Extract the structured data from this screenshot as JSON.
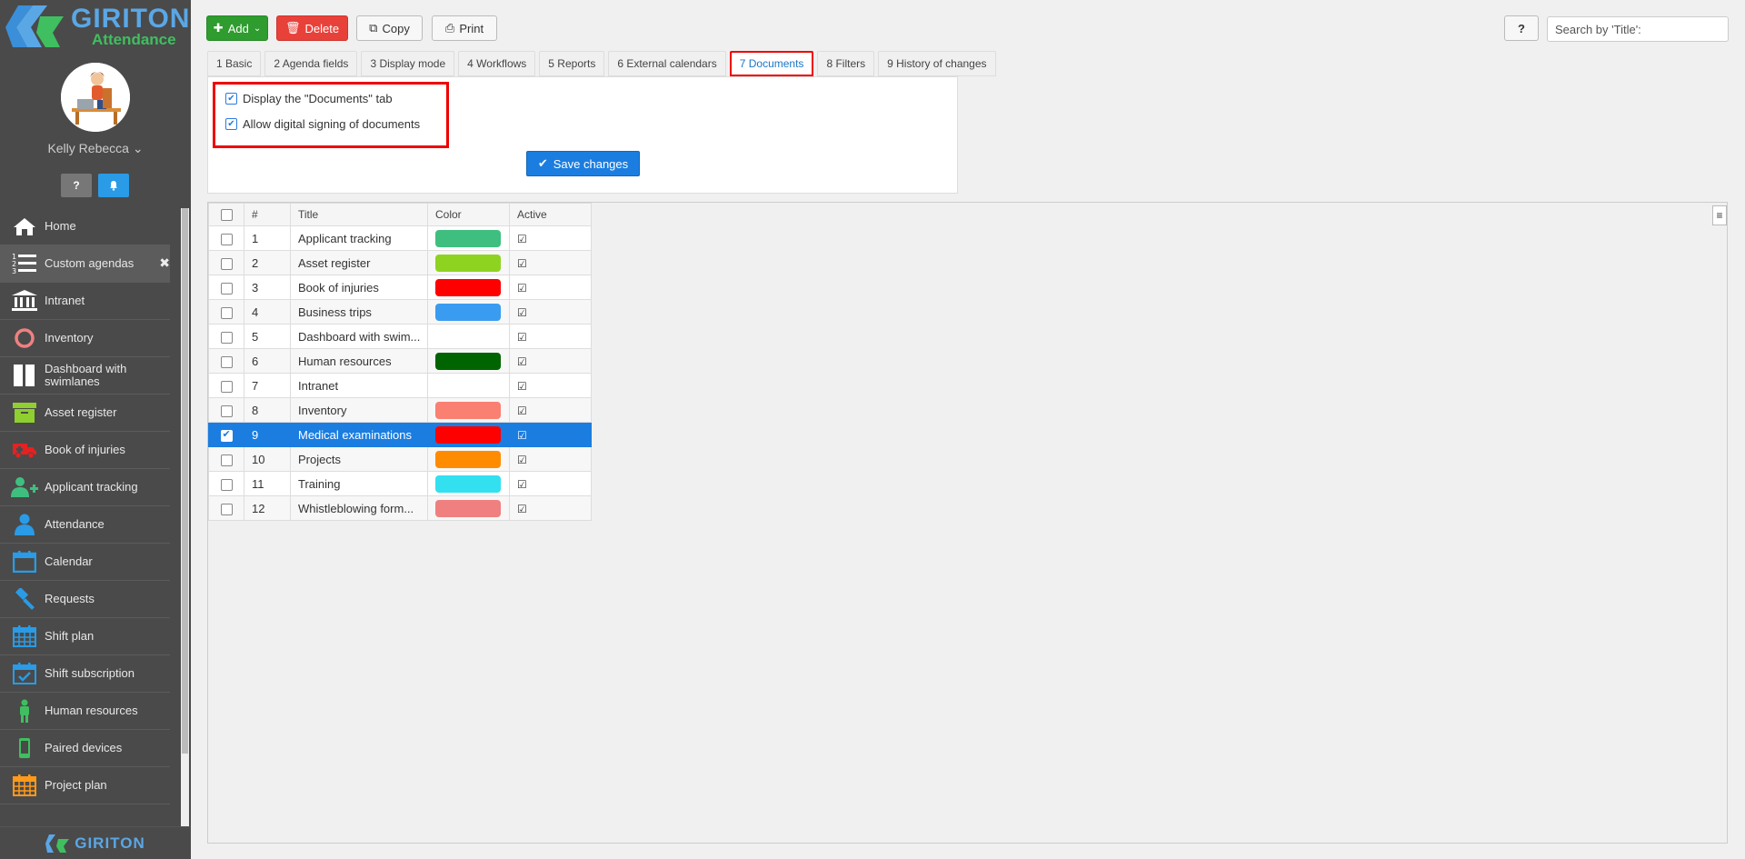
{
  "brand": {
    "name": "GIRITON",
    "product": "Attendance",
    "footer_name": "GIRITON"
  },
  "user": {
    "name": "Kelly Rebecca"
  },
  "sidebar": {
    "help_label": "?",
    "items": [
      {
        "label": "Home",
        "icon": "home-icon",
        "color": "#ffffff"
      },
      {
        "label": "Custom agendas",
        "icon": "numbered-list-icon",
        "color": "#ffffff",
        "active": true,
        "close": "✖"
      },
      {
        "label": "Intranet",
        "icon": "building-icon",
        "color": "#ffffff"
      },
      {
        "label": "Inventory",
        "icon": "circle-icon",
        "color": "#f08080"
      },
      {
        "label": "Dashboard with swimlanes",
        "icon": "columns-icon",
        "color": "#ffffff"
      },
      {
        "label": "Asset register",
        "icon": "archive-box-icon",
        "color": "#8fcf2f"
      },
      {
        "label": "Book of injuries",
        "icon": "ambulance-icon",
        "color": "#e82020"
      },
      {
        "label": "Applicant tracking",
        "icon": "user-plus-icon",
        "color": "#3fbf7f"
      },
      {
        "label": "Attendance",
        "icon": "user-icon",
        "color": "#2a9be6"
      },
      {
        "label": "Calendar",
        "icon": "calendar-icon",
        "color": "#2a9be6"
      },
      {
        "label": "Requests",
        "icon": "gavel-icon",
        "color": "#2a9be6"
      },
      {
        "label": "Shift plan",
        "icon": "calendar-grid-icon",
        "color": "#2a9be6"
      },
      {
        "label": "Shift subscription",
        "icon": "calendar-check-icon",
        "color": "#2a9be6"
      },
      {
        "label": "Human resources",
        "icon": "person-icon",
        "color": "#3fbf5f"
      },
      {
        "label": "Paired devices",
        "icon": "mobile-icon",
        "color": "#3fbf5f"
      },
      {
        "label": "Project plan",
        "icon": "calendar-grid-icon",
        "color": "#ff9a1a"
      }
    ]
  },
  "toolbar": {
    "add": "Add",
    "delete": "Delete",
    "copy": "Copy",
    "print": "Print",
    "help": "?",
    "search_placeholder": "Search by 'Title':"
  },
  "tabs": [
    {
      "label": "1 Basic"
    },
    {
      "label": "2 Agenda fields"
    },
    {
      "label": "3 Display mode"
    },
    {
      "label": "4 Workflows"
    },
    {
      "label": "5 Reports"
    },
    {
      "label": "6 External calendars"
    },
    {
      "label": "7 Documents",
      "active": true
    },
    {
      "label": "8 Filters"
    },
    {
      "label": "9 History of changes"
    }
  ],
  "documents_settings": {
    "display_tab": {
      "label": "Display the \"Documents\" tab",
      "checked": true
    },
    "digital_signing": {
      "label": "Allow digital signing of documents",
      "checked": true
    },
    "save_label": "Save changes"
  },
  "grid": {
    "columns": [
      "#",
      "Title",
      "Color",
      "Active"
    ],
    "rows": [
      {
        "num": "1",
        "title": "Applicant tracking",
        "color": "#3fbf7f",
        "active": true,
        "selected": false
      },
      {
        "num": "2",
        "title": "Asset register",
        "color": "#8fd321",
        "active": true,
        "selected": false
      },
      {
        "num": "3",
        "title": "Book of injuries",
        "color": "#ff0000",
        "active": true,
        "selected": false
      },
      {
        "num": "4",
        "title": "Business trips",
        "color": "#3a9cf0",
        "active": true,
        "selected": false
      },
      {
        "num": "5",
        "title": "Dashboard with swim...",
        "color": "",
        "active": true,
        "selected": false
      },
      {
        "num": "6",
        "title": "Human resources",
        "color": "#006400",
        "active": true,
        "selected": false
      },
      {
        "num": "7",
        "title": "Intranet",
        "color": "",
        "active": true,
        "selected": false
      },
      {
        "num": "8",
        "title": "Inventory",
        "color": "#fa8072",
        "active": true,
        "selected": false
      },
      {
        "num": "9",
        "title": "Medical examinations",
        "color": "#ff0000",
        "active": true,
        "selected": true
      },
      {
        "num": "10",
        "title": "Projects",
        "color": "#ff8c00",
        "active": true,
        "selected": false
      },
      {
        "num": "11",
        "title": "Training",
        "color": "#33e0f0",
        "active": true,
        "selected": false
      },
      {
        "num": "12",
        "title": "Whistleblowing form...",
        "color": "#f08080",
        "active": true,
        "selected": false
      }
    ]
  }
}
